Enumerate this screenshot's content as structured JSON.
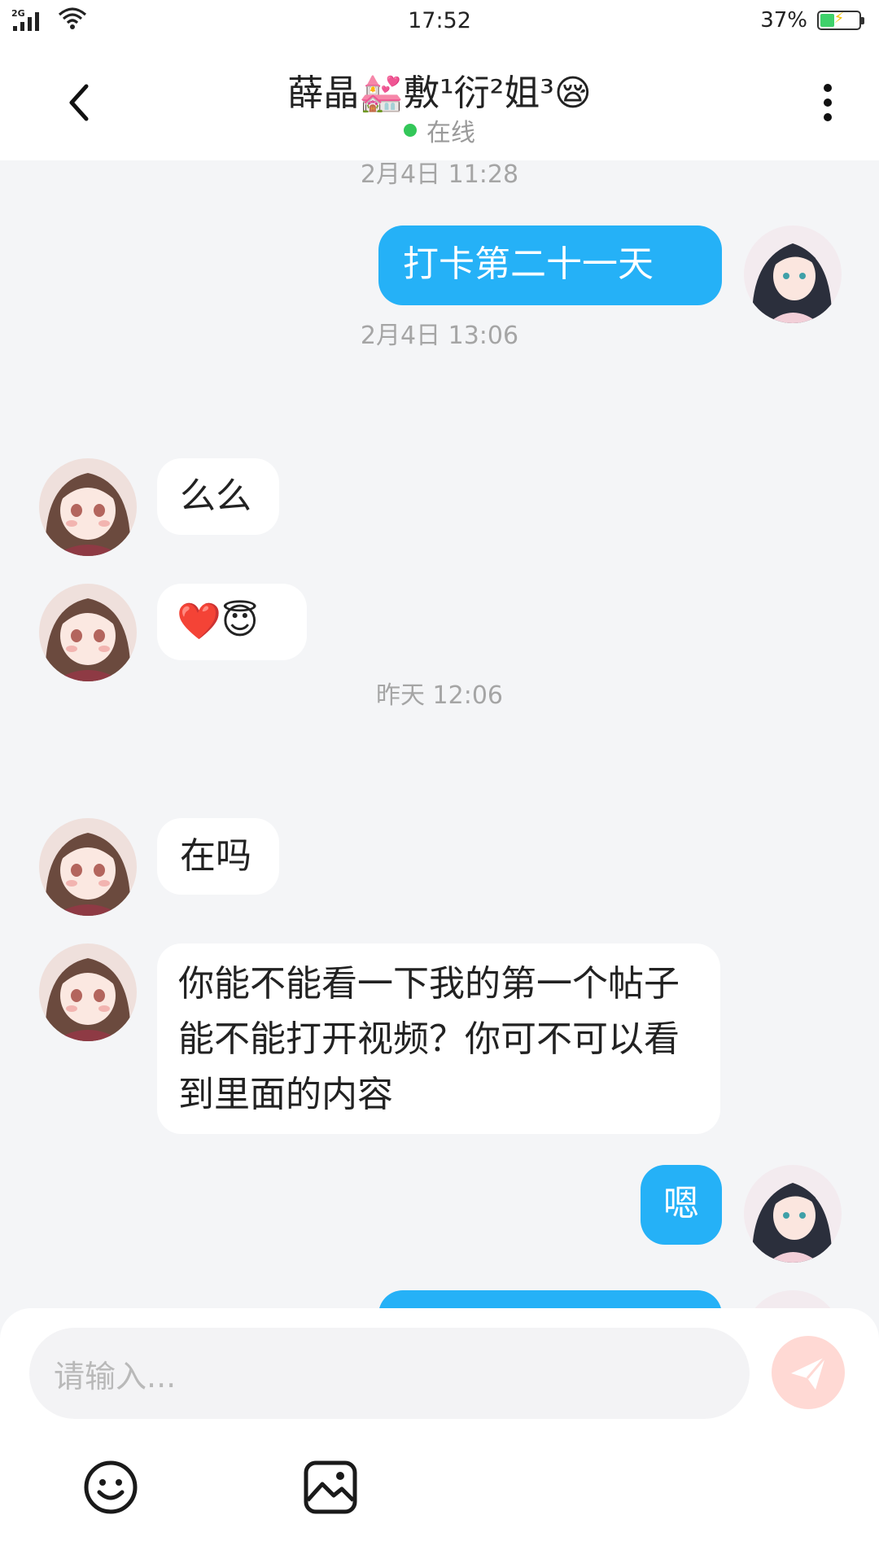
{
  "status_bar": {
    "network": "2G",
    "time": "17:52",
    "battery_percent": "37%",
    "battery_level": 0.37
  },
  "header": {
    "title": "薛晶💒敷¹衍²姐³😪",
    "status": "在线"
  },
  "messages": [
    {
      "kind": "time",
      "text": "2月4日 11:28"
    },
    {
      "kind": "out",
      "text": "打卡第二十一天"
    },
    {
      "kind": "time",
      "text": "2月4日 13:06"
    },
    {
      "kind": "in",
      "text": "么么"
    },
    {
      "kind": "in",
      "text": "❤️😇"
    },
    {
      "kind": "time",
      "text": "昨天 12:06"
    },
    {
      "kind": "in",
      "text": "在吗"
    },
    {
      "kind": "in",
      "text": "你能不能看一下我的第一个帖子能不能打开视频？你可不可以看到里面的内容"
    },
    {
      "kind": "out",
      "text": "嗯"
    }
  ],
  "composer": {
    "placeholder": "请输入..."
  },
  "colors": {
    "accent": "#25b1f7",
    "online": "#33c759",
    "send_disabled": "#ffd9d4",
    "background": "#f4f5f7"
  },
  "icons": {
    "back": "back-arrow-icon",
    "more": "more-vertical-icon",
    "send": "send-icon",
    "emoji": "emoji-icon",
    "image": "image-icon"
  }
}
